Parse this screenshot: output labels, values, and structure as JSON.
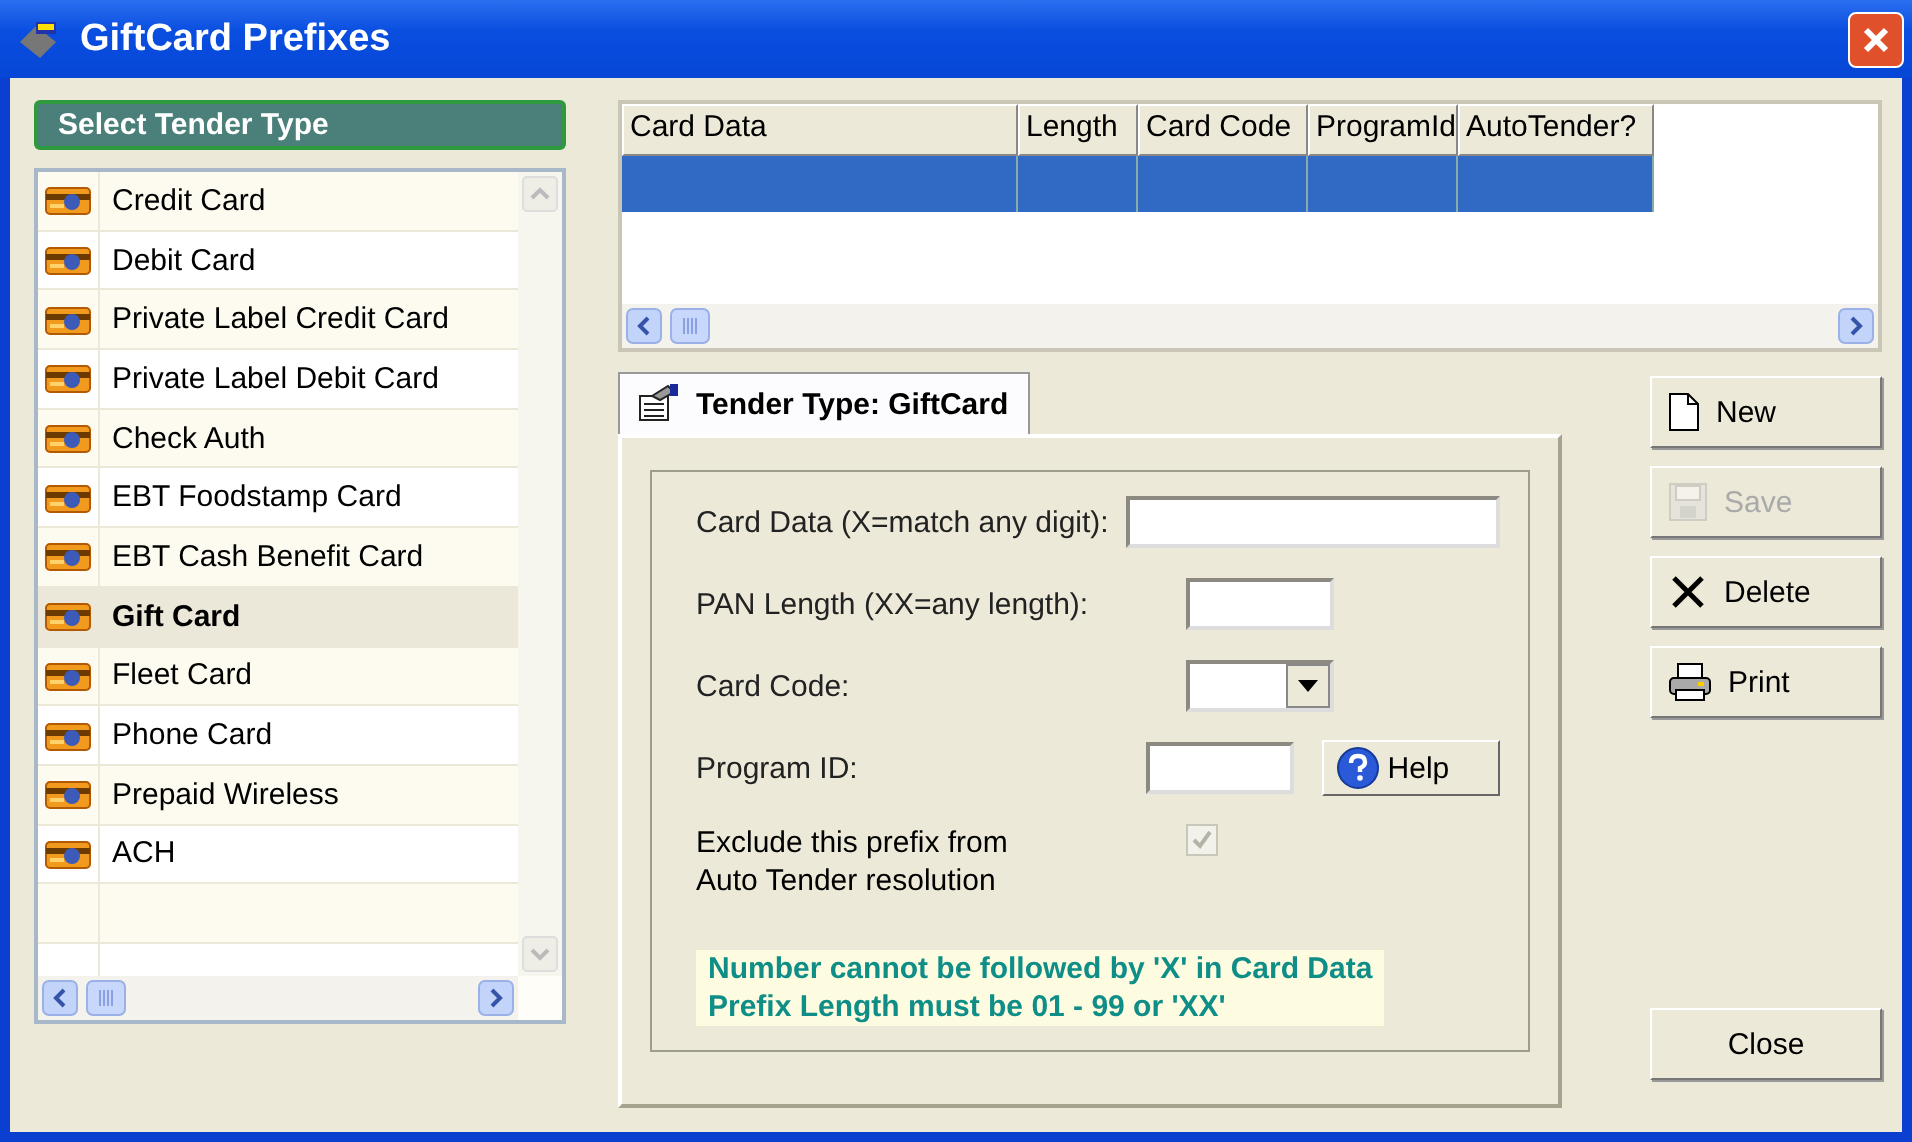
{
  "window": {
    "title": "GiftCard Prefixes"
  },
  "sidebar": {
    "header": "Select Tender Type",
    "items": [
      {
        "label": "Credit Card",
        "selected": false
      },
      {
        "label": "Debit Card",
        "selected": false
      },
      {
        "label": "Private Label Credit Card",
        "selected": false
      },
      {
        "label": "Private Label Debit Card",
        "selected": false
      },
      {
        "label": "Check Auth",
        "selected": false
      },
      {
        "label": "EBT Foodstamp Card",
        "selected": false
      },
      {
        "label": "EBT Cash Benefit Card",
        "selected": false
      },
      {
        "label": "Gift Card",
        "selected": true
      },
      {
        "label": "Fleet Card",
        "selected": false
      },
      {
        "label": "Phone Card",
        "selected": false
      },
      {
        "label": "Prepaid Wireless",
        "selected": false
      },
      {
        "label": "ACH",
        "selected": false
      }
    ]
  },
  "grid": {
    "columns": [
      "Card Data",
      "Length",
      "Card Code",
      "ProgramId",
      "AutoTender?"
    ],
    "rows": [
      {
        "selected": true
      }
    ]
  },
  "tab": {
    "label": "Tender Type: GiftCard",
    "selected": true
  },
  "form": {
    "fields": [
      {
        "kind": "wide-text",
        "label": "Card Data (X=match any digit):"
      },
      {
        "kind": "text",
        "label": "PAN Length (XX=any length):"
      },
      {
        "kind": "dropdown",
        "label": "Card Code:"
      },
      {
        "kind": "text",
        "label": "Program ID:",
        "button": "Help"
      }
    ],
    "checkbox": {
      "label": "Exclude this prefix from\nAuto Tender resolution",
      "checked": true,
      "disabled": true
    },
    "messages": [
      "Number cannot be followed by 'X' in Card Data",
      "Prefix Length must be 01 - 99 or 'XX'"
    ]
  },
  "buttons": [
    {
      "kind": "new",
      "label": "New",
      "disabled": false
    },
    {
      "kind": "save",
      "label": "Save",
      "disabled": true
    },
    {
      "kind": "delete",
      "label": "Delete",
      "disabled": false
    },
    {
      "kind": "print",
      "label": "Print",
      "disabled": false
    }
  ],
  "close_button": {
    "label": "Close"
  }
}
